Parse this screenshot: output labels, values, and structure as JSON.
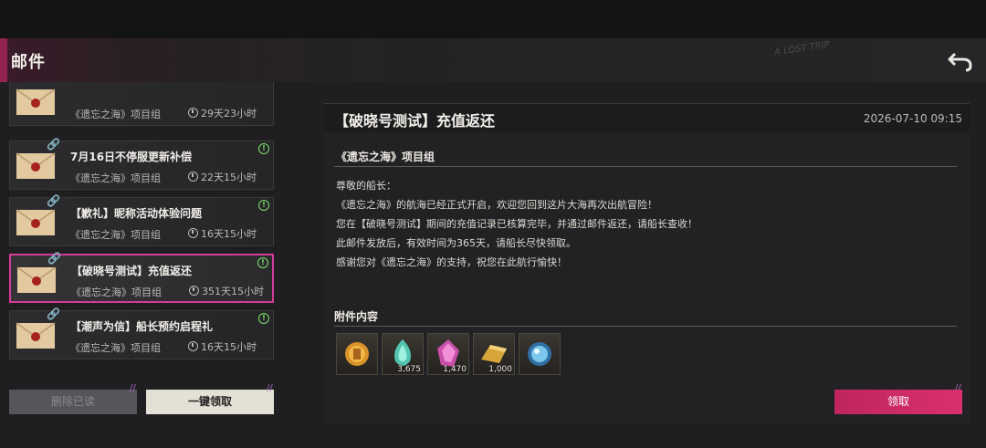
{
  "header": {
    "title": "邮件"
  },
  "mails": [
    {
      "title": "",
      "sender": "《遗忘之海》项目组",
      "time": "29天23小时",
      "selected": false
    },
    {
      "title": "7月16日不停服更新补偿",
      "sender": "《遗忘之海》项目组",
      "time": "22天15小时",
      "selected": false
    },
    {
      "title": "【歉礼】昵称活动体验问题",
      "sender": "《遗忘之海》项目组",
      "time": "16天15小时",
      "selected": false
    },
    {
      "title": "【破晓号测试】充值返还",
      "sender": "《遗忘之海》项目组",
      "time": "351天15小时",
      "selected": true
    },
    {
      "title": "【潮声为信】船长预约启程礼",
      "sender": "《遗忘之海》项目组",
      "time": "16天15小时",
      "selected": false
    }
  ],
  "buttons": {
    "delete_read": "删除已读",
    "claim_all": "一键领取",
    "claim": "领取"
  },
  "detail": {
    "title": "【破晓号测试】充值返还",
    "date": "2026-07-10 09:15",
    "sender": "《遗忘之海》项目组",
    "lines": [
      "尊敬的船长：",
      "《遗忘之海》的航海已经正式开启，欢迎您回到这片大海再次出航冒险！",
      "您在【破晓号测试】期间的充值记录已核算完毕，并通过邮件返还，请船长查收！",
      "此邮件发放后，有效时间为365天，请船长尽快领取。",
      "感谢您对《遗忘之海》的支持，祝您在此航行愉快！"
    ],
    "attachment_label": "附件内容",
    "attachments": [
      {
        "icon": "gold-coin-icon",
        "count": ""
      },
      {
        "icon": "teal-gem-icon",
        "count": "3,675"
      },
      {
        "icon": "pink-gem-icon",
        "count": "1,470"
      },
      {
        "icon": "gold-bar-icon",
        "count": "1,000"
      },
      {
        "icon": "blue-orb-icon",
        "count": ""
      }
    ]
  },
  "colors": {
    "accent": "#d12a6e",
    "claim": "#d02a6a",
    "selected_border": "#d63a9a",
    "alert": "#7ee06e"
  }
}
